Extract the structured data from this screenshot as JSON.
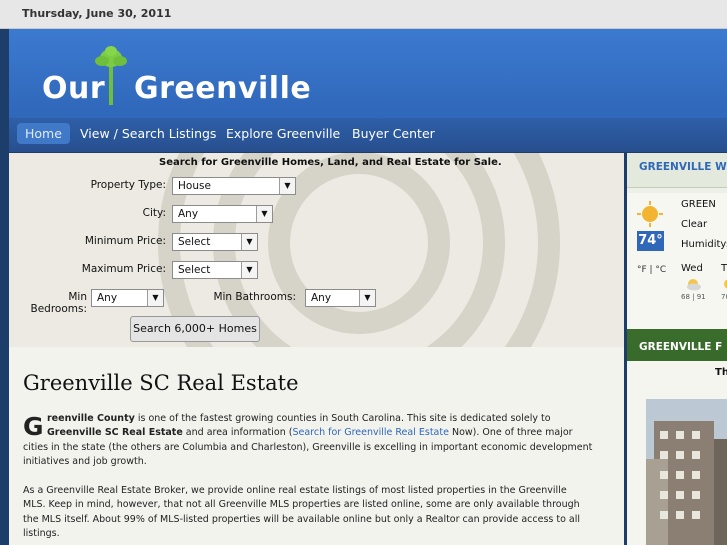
{
  "top_bar": {
    "date": "Thursday, June 30, 2011"
  },
  "brand": {
    "word1": "Our",
    "word2": "Greenville"
  },
  "nav": {
    "items": [
      "Home",
      "View / Search Listings",
      "Explore Greenville",
      "Buyer Center"
    ]
  },
  "search": {
    "title": "Search for Greenville Homes, Land, and Real Estate for Sale.",
    "property_type_label": "Property Type:",
    "property_type_value": "House",
    "city_label": "City:",
    "city_value": "Any",
    "min_price_label": "Minimum Price:",
    "min_price_value": "Select",
    "max_price_label": "Maximum Price:",
    "max_price_value": "Select",
    "min_bed_label": "Min Bedrooms:",
    "min_bed_value": "Any",
    "min_bath_label": "Min Bathrooms:",
    "min_bath_value": "Any",
    "button": "Search 6,000+ Homes"
  },
  "article": {
    "heading": "Greenville SC Real Estate",
    "dropcap": "G",
    "p1_a": "reenville County",
    "p1_b": " is one of the fastest growing counties in South Carolina. This site is dedicated solely to",
    "p1_c": "Greenville SC Real Estate",
    "p1_d": " and area information (",
    "p1_link": "Search for Greenville Real Estate",
    "p1_e": " Now). One of three major",
    "p1_line3": "cities in the state (the others are Columbia and Charleston), Greenville is excelling in important economic development",
    "p1_line4": "initiatives and job growth.",
    "p2_line1": "As a Greenville Real Estate Broker, we provide online real estate listings of most listed properties in the Greenville",
    "p2_line2": "MLS.  Keep in mind, however, that not all Greenville MLS properties are listed online, some are only available through",
    "p2_line3": "the MLS itself.  About 99% of MLS-listed properties will be available online but only a Realtor can provide access to all",
    "p2_line4": "listings."
  },
  "sidebar": {
    "weather_heading": "GREENVILLE W",
    "city": "GREEN",
    "condition": "Clear",
    "temp": "74°",
    "humidity": "Humidity:",
    "units": "°F | °C",
    "day1": "Wed",
    "day2": "T",
    "day1_temps": "68 | 91",
    "day2_temps": "70",
    "feature_heading": "GREENVILLE F",
    "feature_sub": "Th"
  }
}
